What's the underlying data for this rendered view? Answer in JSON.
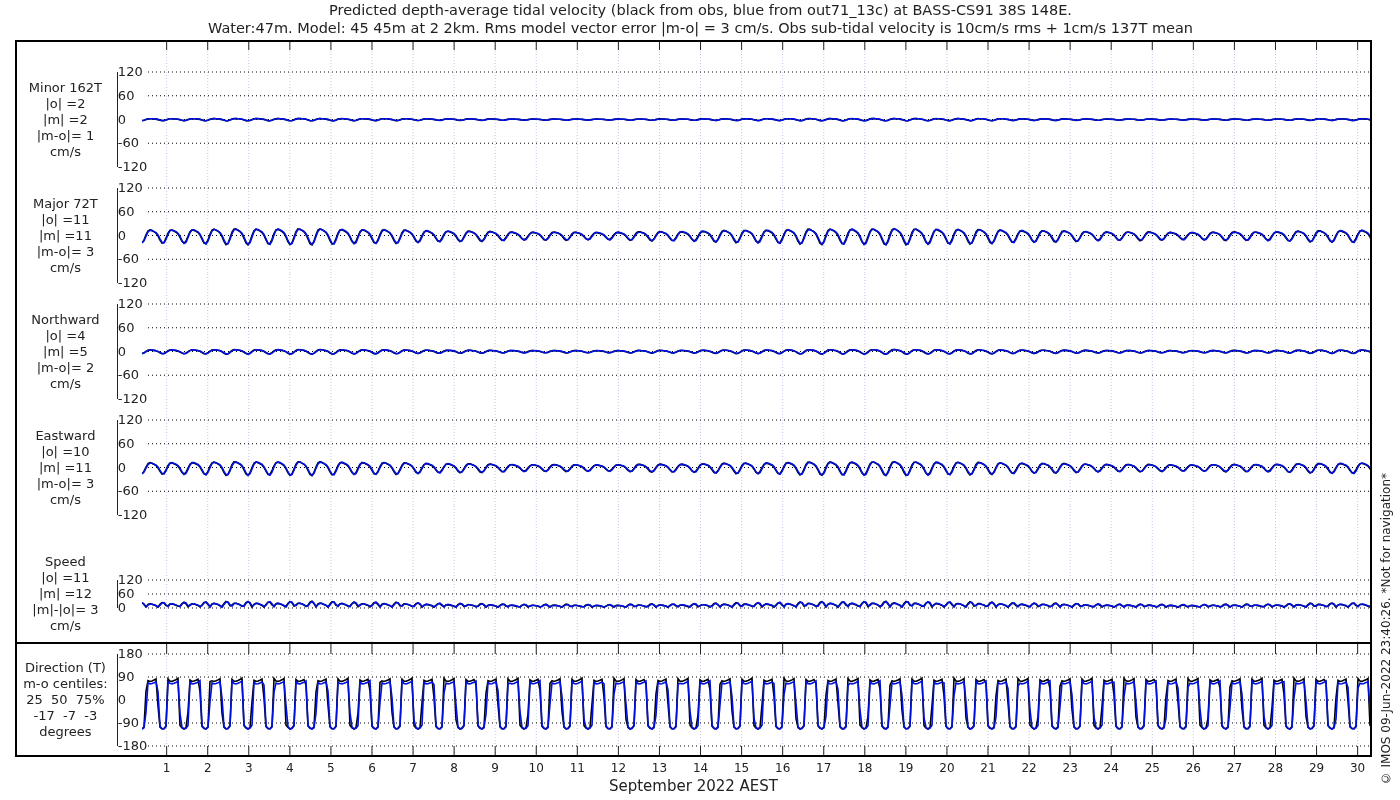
{
  "title": {
    "line_1": "Predicted depth-average tidal velocity (black from obs, blue from out71_13c) at BASS-CS91 38S 148E.",
    "line_2": "Water:47m. Model: 45 45m at 2 2km. Rms model vector error |m-o| = 3 cm/s. Obs sub-tidal velocity is 10cm/s rms + 1cm/s 137T mean"
  },
  "panels": [
    {
      "kind": "vector",
      "label_lines": [
        "Minor 162T",
        "|o| =2",
        "|m| =2",
        "|m-o|= 1",
        "cm/s"
      ],
      "yticks": [
        "120",
        "60",
        "0",
        "-60",
        "-120"
      ]
    },
    {
      "kind": "vector",
      "label_lines": [
        "Major 72T",
        "|o| =11",
        "|m| =11",
        "|m-o|= 3",
        "cm/s"
      ],
      "yticks": [
        "120",
        "60",
        "0",
        "-60",
        "-120"
      ]
    },
    {
      "kind": "vector",
      "label_lines": [
        "Northward",
        "|o| =4",
        "|m| =5",
        "|m-o|= 2",
        "cm/s"
      ],
      "yticks": [
        "120",
        "60",
        "0",
        "-60",
        "-120"
      ]
    },
    {
      "kind": "vector",
      "label_lines": [
        "Eastward",
        "|o| =10",
        "|m| =11",
        "|m-o|= 3",
        "cm/s"
      ],
      "yticks": [
        "120",
        "60",
        "0",
        "-60",
        "-120"
      ]
    },
    {
      "kind": "speed",
      "label_lines": [
        "Speed",
        "|o| =11",
        "|m| =12",
        "|m|-|o|= 3",
        "cm/s"
      ],
      "yticks": [
        "120",
        "60",
        "0"
      ]
    },
    {
      "kind": "direction",
      "label_lines": [
        "Direction (T)",
        "m-o centiles:",
        "25  50  75%",
        "-17  -7  -3",
        "degrees"
      ],
      "yticks": [
        "180",
        "90",
        "0",
        "-90",
        "-180"
      ]
    }
  ],
  "xticks": [
    "1",
    "2",
    "3",
    "4",
    "5",
    "6",
    "7",
    "8",
    "9",
    "10",
    "11",
    "12",
    "13",
    "14",
    "15",
    "16",
    "17",
    "18",
    "19",
    "20",
    "21",
    "22",
    "23",
    "24",
    "25",
    "26",
    "27",
    "28",
    "29",
    "30"
  ],
  "xlabel": "September 2022 AEST",
  "footer": "© IMOS 09-Jun-2022 23:40:26. *Not for navigation*"
}
